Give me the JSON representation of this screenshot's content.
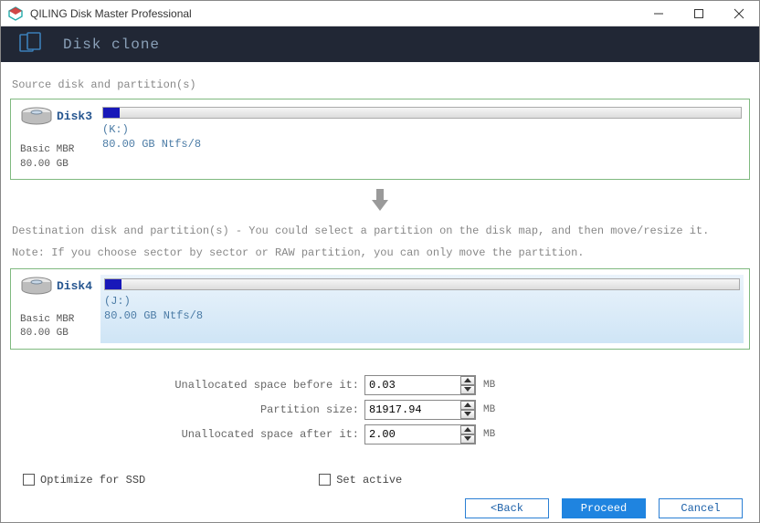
{
  "window": {
    "title": "QILING Disk Master Professional"
  },
  "header": {
    "title": "Disk clone"
  },
  "source": {
    "section_label": "Source disk and partition(s)",
    "disk_name": "Disk3",
    "disk_type": "Basic MBR",
    "disk_size": "80.00 GB",
    "partition_drive": "(K:)",
    "partition_desc": "80.00 GB Ntfs/8"
  },
  "dest": {
    "section_label": "Destination disk and partition(s) - You could select a partition on the disk map, and then move/resize it.",
    "note": "Note: If you choose sector by sector or RAW partition, you can only move the partition.",
    "disk_name": "Disk4",
    "disk_type": "Basic MBR",
    "disk_size": "80.00 GB",
    "partition_drive": "(J:)",
    "partition_desc": "80.00 GB Ntfs/8"
  },
  "fields": {
    "before_label": "Unallocated space before it:",
    "before_value": "0.03",
    "size_label": "Partition size:",
    "size_value": "81917.94",
    "after_label": "Unallocated space after it:",
    "after_value": "2.00",
    "unit": "MB"
  },
  "options": {
    "ssd_label": "Optimize for SSD",
    "active_label": "Set active"
  },
  "buttons": {
    "back": "<Back",
    "proceed": "Proceed",
    "cancel": "Cancel"
  }
}
